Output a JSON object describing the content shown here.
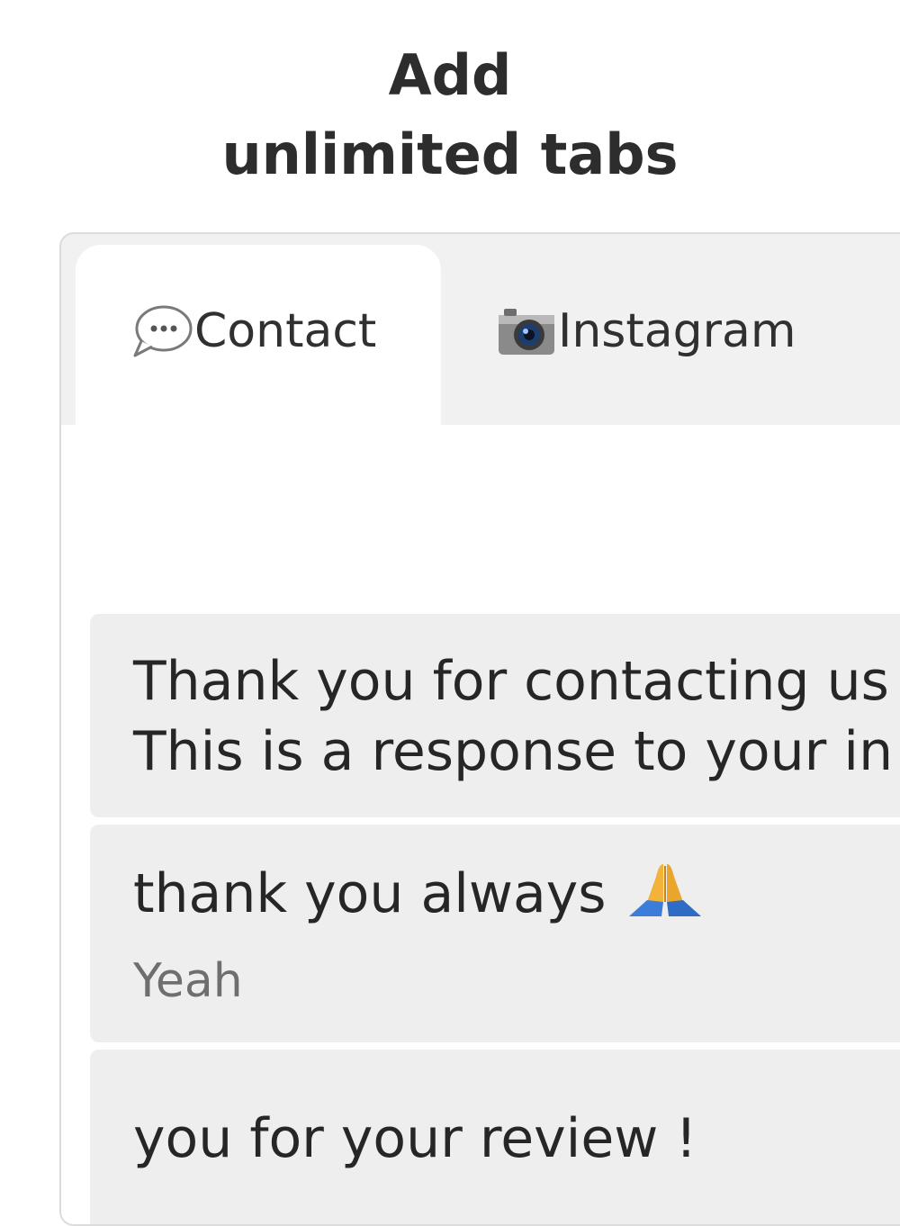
{
  "headline": {
    "line1": "Add",
    "line2": "unlimited tabs"
  },
  "tabs": [
    {
      "label": "Contact",
      "icon": "speech-bubble-icon",
      "active": true
    },
    {
      "label": "Instagram",
      "icon": "camera-icon",
      "active": false
    }
  ],
  "messages": [
    {
      "line1": "Thank you for contacting us",
      "line2": "This is a response to your in"
    },
    {
      "text": "thank you always",
      "emoji": "folded-hands-icon",
      "reply": "Yeah"
    },
    {
      "text": " you for your review !"
    }
  ],
  "colors": {
    "frame_bg": "#f1f1f1",
    "bubble_bg": "#eeeeee",
    "headline": "#2d2d2d"
  }
}
